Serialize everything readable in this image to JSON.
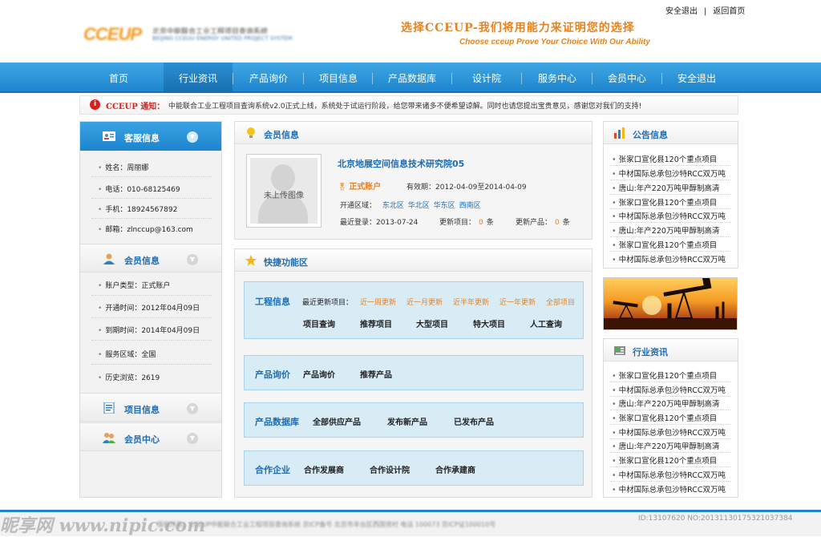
{
  "header": {
    "logo_mark": "CCEUP",
    "logo_name": "北京中能联合工业工程项目查询系统",
    "logo_sub": "BEIJING CCEUU ENERGY UNITED PROJECT SYSTEM",
    "slogan": "选择CCEUP-我们将用能力来证明您的选择",
    "slogan_en": "Choose cceup Prove Your Choice With Our Ability",
    "links": [
      "安全退出",
      "|",
      "返回首页"
    ]
  },
  "nav": {
    "items": [
      "首页",
      "行业资讯",
      "产品询价",
      "项目信息",
      "产品数据库",
      "设计院",
      "服务中心",
      "会员中心",
      "安全退出"
    ],
    "active": "行业资讯"
  },
  "notice": {
    "brand": "CCEUP 通知：",
    "text": "中能联合工业工程项目查询系统v2.0正式上线，系统处于试运行阶段，给您带来诸多不便希望谅解。同时也请您提出宝贵意见，感谢您对我们的支持!"
  },
  "sidebar": {
    "service": {
      "title": "客服信息",
      "rows": [
        "姓名：周丽娜",
        "电话：010-68125469",
        "手机：18924567892",
        "邮箱：zlnccup@163.com"
      ]
    },
    "member": {
      "title": "会员信息",
      "rows": [
        "账户类型：正式账户",
        "开通时间：2012年04月09日",
        "到期时间：2014年04月09日",
        "服务区域：全国",
        "历史浏览：2619"
      ]
    },
    "project": {
      "title": "项目信息"
    },
    "center": {
      "title": "会员中心"
    }
  },
  "member_panel": {
    "title": "会员信息",
    "avatar_caption": "未上传图像",
    "company": "北京地展空间信息技术研究院05",
    "account_label": "正式账户",
    "validity_label": "有效期：",
    "validity": "2012-04-09至2014-04-09",
    "region_label": "开通区域：",
    "regions": [
      "东北区",
      "华北区",
      "华东区",
      "西南区"
    ],
    "last_login_label": "最近登录：",
    "last_login": "2013-07-24",
    "updated_projects_label": "更新项目：",
    "updated_projects": "0",
    "updated_products_label": "更新产品：",
    "updated_products": "0",
    "unit": "条"
  },
  "quick_panel": {
    "title": "快捷功能区",
    "engineering": {
      "title": "工程信息",
      "recent_label": "最近更新项目：",
      "recent": [
        "近一周更新",
        "近一月更新",
        "近半年更新",
        "近一年更新",
        "全部项目"
      ],
      "links": [
        "项目查询",
        "推荐项目",
        "大型项目",
        "特大项目",
        "人工查询"
      ]
    },
    "inquiry": {
      "title": "产品询价",
      "links": [
        "产品询价",
        "推荐产品"
      ]
    },
    "database": {
      "title": "产品数据库",
      "links": [
        "全部供应产品",
        "发布新产品",
        "已发布产品"
      ]
    },
    "partners": {
      "title": "合作企业",
      "links": [
        "合作发展商",
        "合作设计院",
        "合作承建商"
      ]
    }
  },
  "right": {
    "announcements": {
      "title": "公告信息",
      "items": [
        "张家口宣化县120个重点项目",
        "中材国际总承包沙特RCC双万吨",
        "唐山:年产220万吨甲醇制高清",
        "张家口宣化县120个重点项目",
        "中材国际总承包沙特RCC双万吨",
        "唐山:年产220万吨甲醇制高清",
        "张家口宣化县120个重点项目",
        "中材国际总承包沙特RCC双万吨"
      ]
    },
    "industry": {
      "title": "行业资讯",
      "items": [
        "张家口宣化县120个重点项目",
        "中材国际总承包沙特RCC双万吨",
        "唐山:年产220万吨甲醇制高清",
        "张家口宣化县120个重点项目",
        "中材国际总承包沙特RCC双万吨",
        "唐山:年产220万吨甲醇制高清",
        "张家口宣化县120个重点项目",
        "中材国际总承包沙特RCC双万吨",
        "唐山:年产220万吨甲醇制高清",
        "中材国际总承包沙特RCC双万吨"
      ]
    }
  },
  "footer": {
    "text": "版权所有：CCEUP中能联合工业工程项目查询系统 京ICP备号 北京市丰台区西国贤村 电话 100073 京ICP证100010号",
    "watermark_left": "昵享网 www.nipic.com",
    "watermark_right": "ID:13107620 NO:20131130175321037384"
  }
}
